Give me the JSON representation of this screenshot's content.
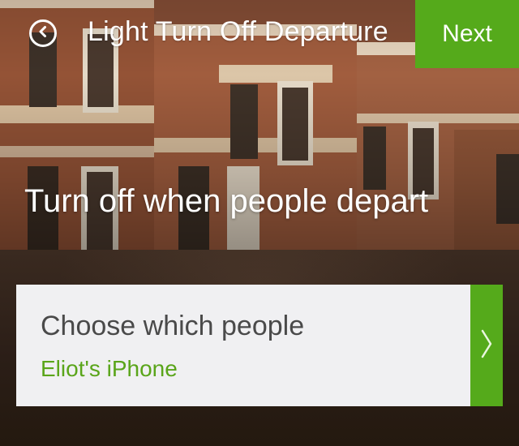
{
  "header": {
    "title": "Light Turn Off Departure",
    "back_icon": "back-circle-icon",
    "next_label": "Next"
  },
  "hero": {
    "heading": "Turn off when people depart"
  },
  "people_selector": {
    "title": "Choose which people",
    "value": "Eliot's iPhone",
    "chevron_icon": "chevron-right-icon"
  },
  "colors": {
    "accent_green": "#55aa1b",
    "card_bg": "#f0f0f2",
    "subtitle_green": "#5aa51a"
  }
}
